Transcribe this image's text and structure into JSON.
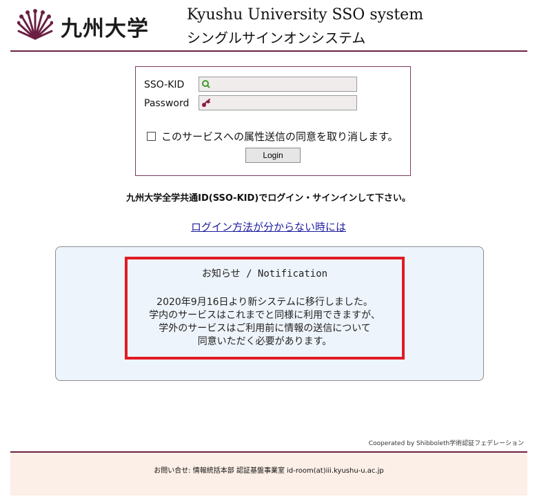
{
  "header": {
    "logo_text": "九州大学",
    "title_en": "Kyushu University SSO system",
    "title_ja": "シングルサインオンシステム"
  },
  "login": {
    "id_label": "SSO-KID",
    "id_value": "",
    "id_icon": "user-search-icon",
    "password_label": "Password",
    "password_value": "",
    "password_icon": "key-icon",
    "consent_label": "このサービスへの属性送信の同意を取り消します。",
    "consent_checked": false,
    "login_button": "Login"
  },
  "instruction": "九州大学全学共通ID(SSO-KID)でログイン・サインインして下さい。",
  "help_link": "ログイン方法が分からない時には",
  "notice": {
    "title": "お知らせ / Notification",
    "lines": [
      "2020年9月16日より新システムに移行しました。",
      "学内のサービスはこれまでと同様に利用できますが、",
      "学外のサービスはご利用前に情報の送信について",
      "同意いただく必要があります。"
    ],
    "highlight_color": "#e01b24"
  },
  "cooperated": "Cooperated by Shibboleth学術認証フェデレーション",
  "footer": {
    "contact": "お問い合せ: 情報統括本部  認証基盤事業室  id-room(at)iii.kyushu-u.ac.jp"
  },
  "colors": {
    "brand": "#6b2043",
    "link": "#1e1ea0",
    "notice_bg": "#eef4fb",
    "footer_bg": "#fcefe7"
  }
}
